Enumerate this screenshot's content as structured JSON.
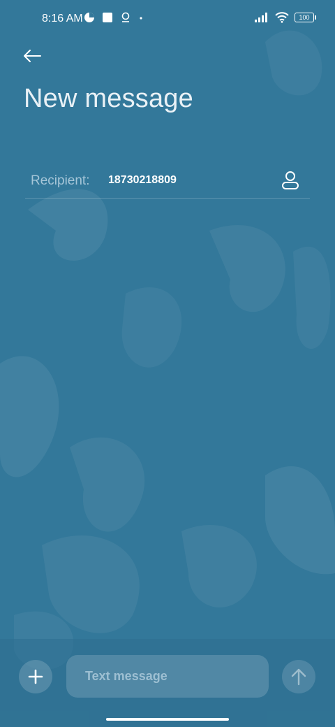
{
  "status_bar": {
    "time": "8:16 AM",
    "battery": "100",
    "icons_left": [
      "pie-chart-icon",
      "square-notification-icon",
      "location-pin-icon",
      "dot-icon"
    ],
    "icons_right": [
      "signal-icon",
      "wifi-icon",
      "battery-icon"
    ]
  },
  "header": {
    "back_icon": "arrow-left-icon",
    "title": "New message"
  },
  "recipient": {
    "label": "Recipient:",
    "value": "18730218809",
    "contact_icon": "person-icon"
  },
  "compose": {
    "attach_icon": "plus-icon",
    "placeholder": "Text message",
    "value": "",
    "send_icon": "arrow-up-icon"
  },
  "colors": {
    "background": "#33789a",
    "text_primary": "#ffffff",
    "text_secondary": "#a6c6d8"
  }
}
